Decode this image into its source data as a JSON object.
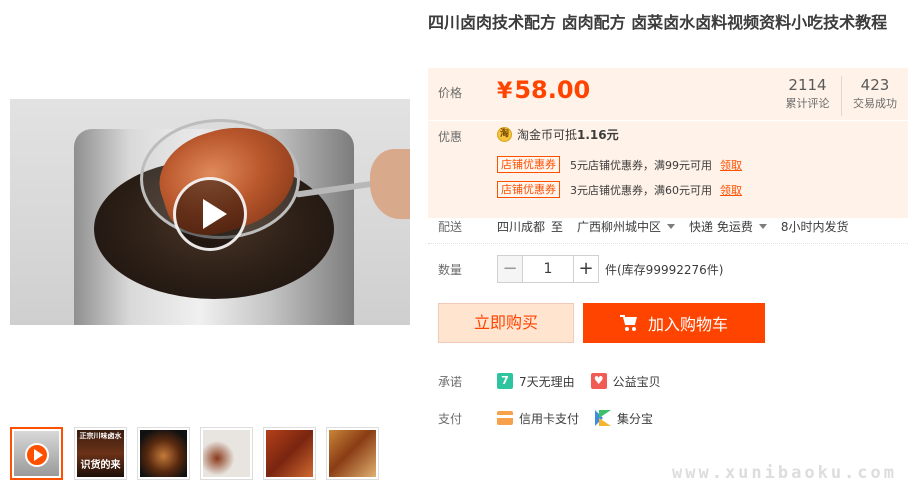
{
  "product": {
    "title": "四川卤肉技术配方 卤肉配方 卤菜卤水卤料视频资料小吃技术教程"
  },
  "gallery": {
    "thumbnails": [
      {
        "name": "thumb-video",
        "caption": "",
        "active": true
      },
      {
        "name": "thumb-2",
        "caption": "识货的来",
        "top_caption": "正宗川味卤水"
      },
      {
        "name": "thumb-3",
        "caption": "",
        "top_caption": ""
      },
      {
        "name": "thumb-4",
        "caption": ""
      },
      {
        "name": "thumb-5",
        "caption": ""
      },
      {
        "name": "thumb-6",
        "caption": ""
      }
    ]
  },
  "price": {
    "label": "价格",
    "currency": "¥",
    "value": "58.00",
    "reviews_count": "2114",
    "reviews_label": "累计评论",
    "sales_count": "423",
    "sales_label": "交易成功"
  },
  "promo": {
    "label": "优惠",
    "coin_icon": "淘",
    "coin_text_prefix": "淘金币可抵",
    "coin_amount": "1.16元",
    "coupons": [
      {
        "tag": "店铺优惠券",
        "desc": "5元店铺优惠券，满99元可用",
        "link": "领取"
      },
      {
        "tag": "店铺优惠券",
        "desc": "3元店铺优惠券，满60元可用",
        "link": "领取"
      }
    ]
  },
  "shipping": {
    "label": "配送",
    "from": "四川成都",
    "to_word": "至",
    "destination": "广西柳州城中区",
    "express": "快递 免运费",
    "dispatch": "8小时内发货"
  },
  "quantity": {
    "label": "数量",
    "minus": "−",
    "value": "1",
    "plus": "+",
    "unit_stock": "件(库存99992276件)"
  },
  "actions": {
    "buy_now": "立即购买",
    "add_to_cart": "加入购物车"
  },
  "promise": {
    "label": "承诺",
    "items": [
      {
        "icon_text": "7",
        "text": "7天无理由"
      },
      {
        "text": "公益宝贝"
      }
    ]
  },
  "payment": {
    "label": "支付",
    "items": [
      {
        "text": "信用卡支付"
      },
      {
        "text": "集分宝"
      }
    ]
  },
  "watermark": "www.xunibaoku.com",
  "colors": {
    "accent": "#ff4400",
    "price_bg": "#fff2e8",
    "buy_now_bg": "#ffe4d0"
  }
}
